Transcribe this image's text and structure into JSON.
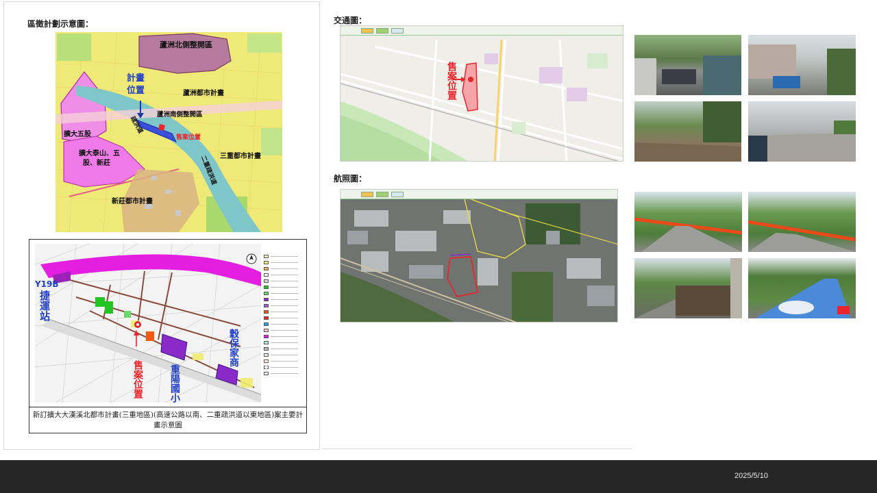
{
  "left": {
    "zoning_title": "區徵計劃示意圖：",
    "zoning_labels": {
      "north_dev": "蘆洲北側整開區",
      "plan_pos_1": "計畫",
      "plan_pos_2": "位置",
      "luzhou_city": "蘆洲都市計畫",
      "expand_wugu": "擴大五股",
      "luzhou_south": "蘆洲南側整開區",
      "sale_pos": "售案位置",
      "sanchong_city": "三重都市計畫",
      "expand_taishan_1": "擴大泰山、五",
      "expand_taishan_2": "股、新莊",
      "xinzhuang_city": "新莊都市計畫",
      "road1": "疏洪道",
      "road2": "二重疏洪道"
    },
    "plan_labels": {
      "y19b": "Y19B",
      "station": "捷運站",
      "sale_pos": "售案位置",
      "school": "重陽國小",
      "market": "穀保家商",
      "north": "N"
    },
    "plan_caption": "新訂擴大大漢溪北都市計畫(三重地區)(高速公路以南、二重疏洪道以東地區)案主要計畫示意圖"
  },
  "right": {
    "traffic_title": "交通圖：",
    "traffic_sale_label": "售案位置",
    "aerial_title": "航照圖："
  },
  "footer": {
    "date": "2025/5/10"
  },
  "colors": {
    "footer_bg": "#262626",
    "sale_red": "#e8262c",
    "plan_blue": "#2240c4",
    "zone_magenta": "#e040d8"
  }
}
